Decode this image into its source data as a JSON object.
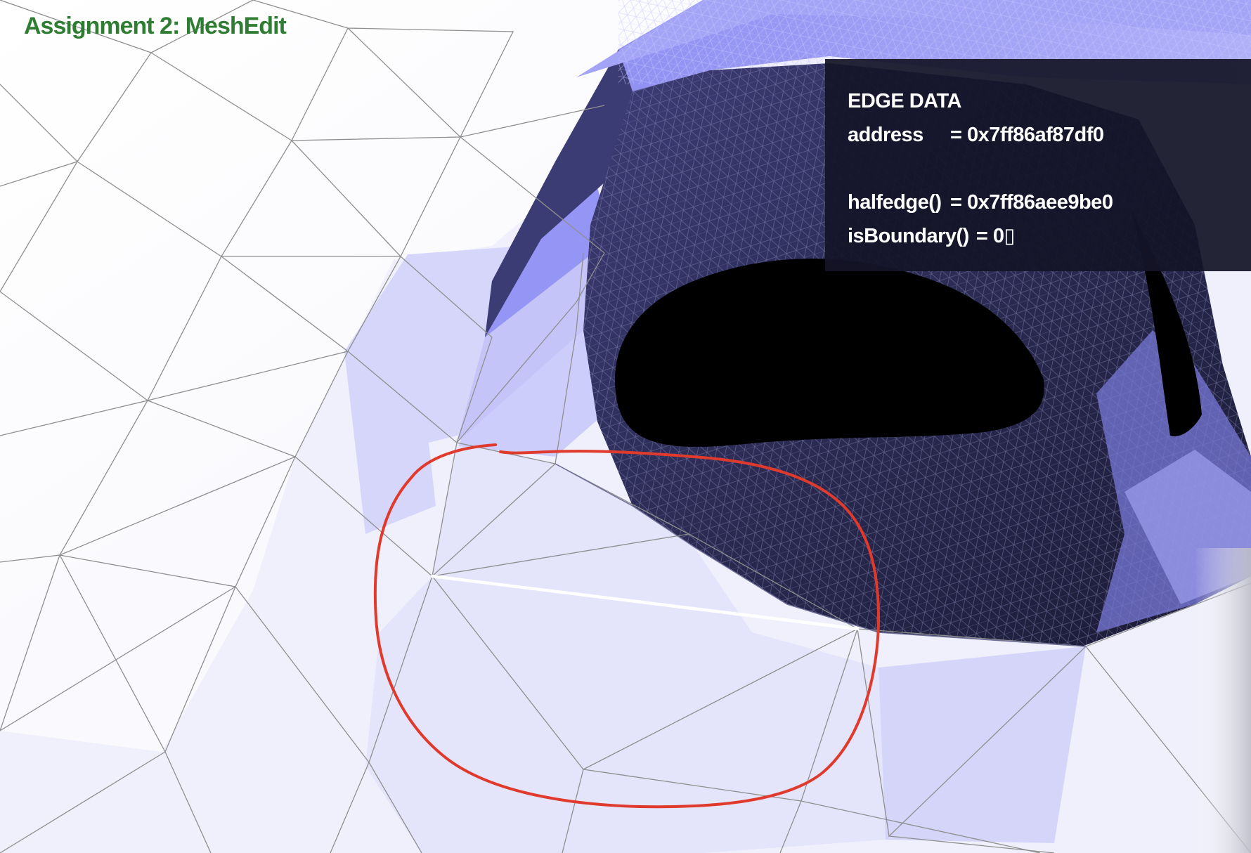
{
  "app": {
    "title": "Assignment 2: MeshEdit"
  },
  "info_panel": {
    "heading": "EDGE DATA",
    "fields": [
      {
        "key": "address",
        "sep": "= ",
        "value": "0x7ff86af87df0"
      },
      {
        "key": "halfedge()",
        "sep": "= ",
        "value": "0x7ff86aee9be0"
      },
      {
        "key": "isBoundary()",
        "sep": "= ",
        "value": "0▯"
      }
    ]
  },
  "colors": {
    "title": "#2e7d32",
    "annotation": "#e03a2c",
    "selected_edge": "#ffffff",
    "mesh_face_light": "#e2e2fb",
    "mesh_face_dark": "#26264a",
    "mesh_face_bright": "#8d8df5",
    "wireframe": "#8a8a8a",
    "hole": "#000000",
    "panel_bg": "#14142a"
  },
  "scene": {
    "selected_element": "edge",
    "annotation": "red freehand circle around selected edge"
  }
}
